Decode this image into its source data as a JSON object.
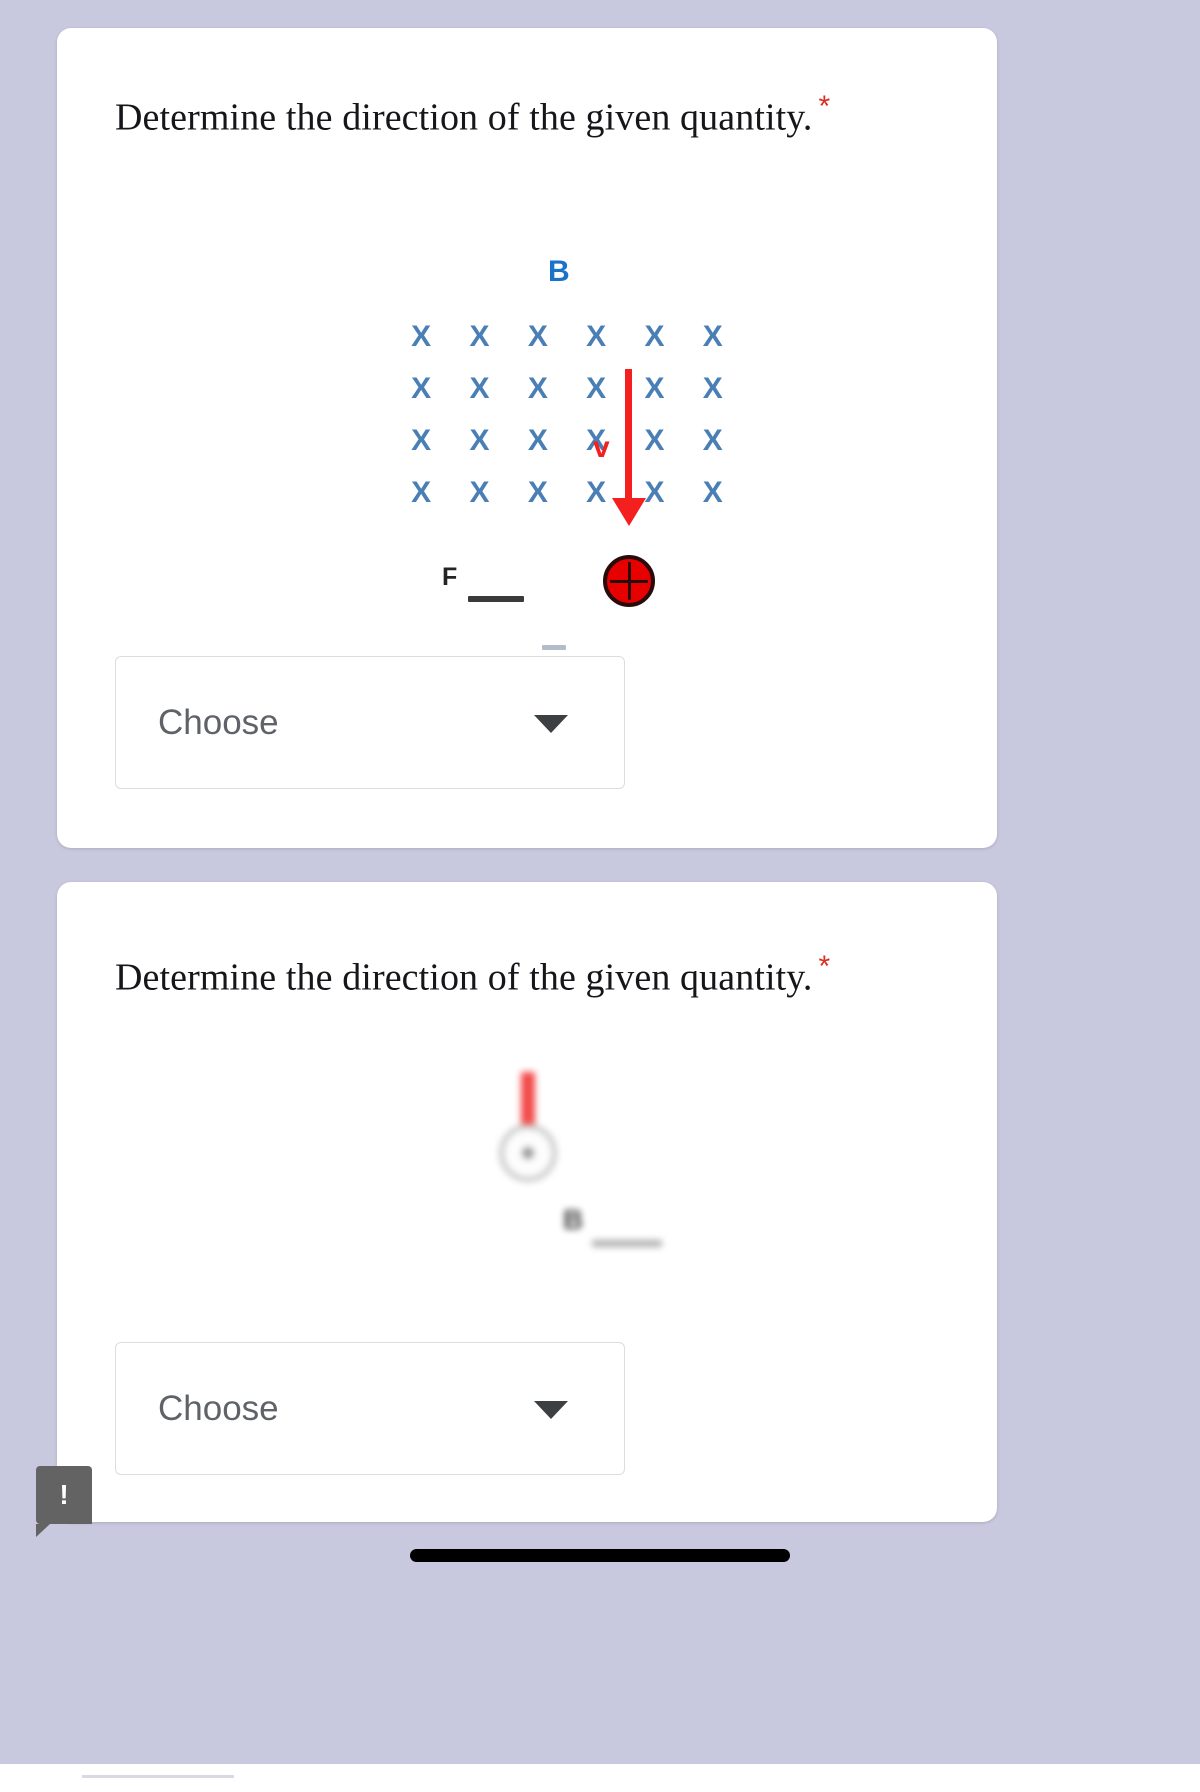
{
  "background_color": "#c8c8de",
  "cards": [
    {
      "id": "question-1",
      "title": "Determine the direction of the given quantity.",
      "required_marker": "*",
      "diagram": {
        "type": "magnetic-field-into-page",
        "field_label": "B",
        "field_label_color": "#1a73c9",
        "x_mark": "X",
        "x_mark_color": "#4a7fb5",
        "grid_rows": 4,
        "grid_columns": 6,
        "velocity_label": "v",
        "velocity_color": "#f41f1f",
        "velocity_direction": "down",
        "force_label": "F",
        "force_blank": "___",
        "charge_symbol": "+",
        "charge_color": "#e60000"
      },
      "dropdown": {
        "value": "Choose",
        "caret_icon": "chevron-down-icon"
      }
    },
    {
      "id": "question-2",
      "title": "Determine the direction of the given quantity.",
      "required_marker": "*",
      "diagram": {
        "type": "blurred-field-diagram",
        "arrow_color": "#f24a4a",
        "arrow_direction": "up",
        "charge_symbol": "dot",
        "field_label": "B",
        "field_blank": "___"
      },
      "dropdown": {
        "value": "Choose",
        "caret_icon": "chevron-down-icon"
      }
    }
  ],
  "notification": {
    "icon": "exclamation-icon",
    "mark": "!"
  }
}
